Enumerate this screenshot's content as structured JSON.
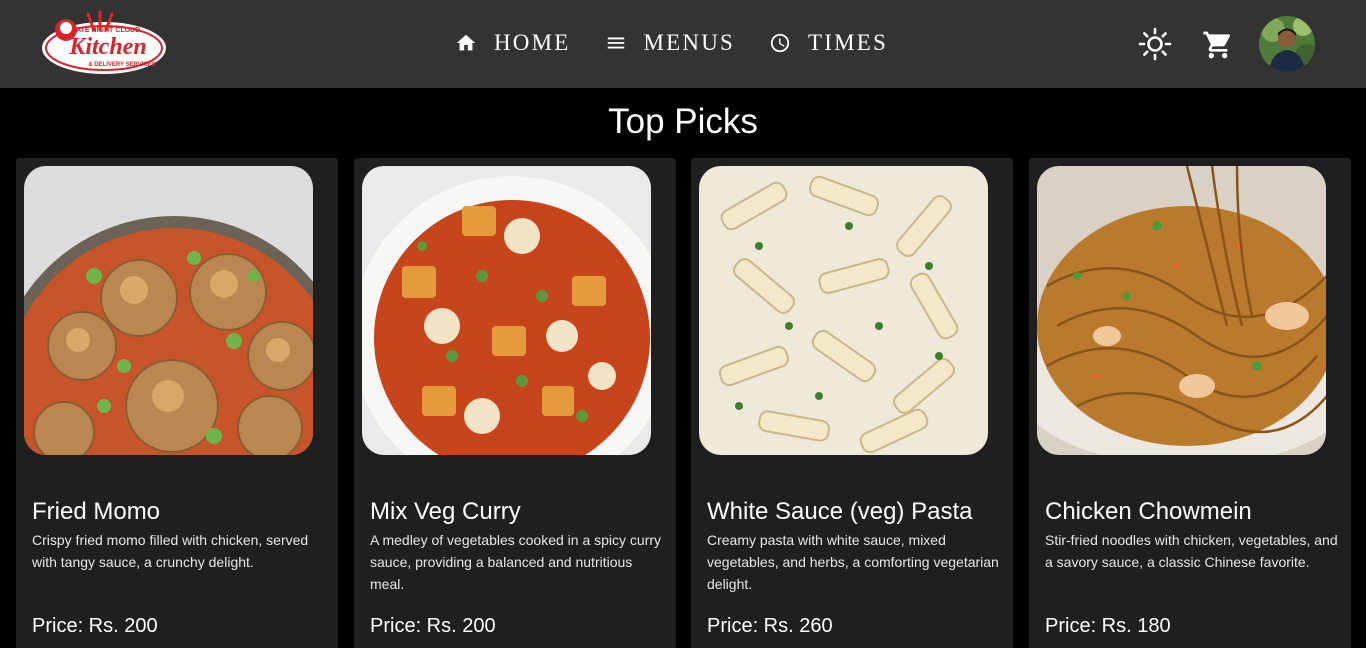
{
  "brand": {
    "logo_line1": "LATE NIGHT CLOUD",
    "logo_line2": "Kitchen",
    "logo_line3": "& DELIVERY SERVICES"
  },
  "nav": {
    "items": [
      {
        "label": "HOME",
        "icon": "home-icon"
      },
      {
        "label": "MENUS",
        "icon": "menu-icon"
      },
      {
        "label": "TIMES",
        "icon": "clock-icon"
      }
    ],
    "theme_icon": "sun-icon",
    "cart_icon": "cart-icon",
    "avatar": "user-avatar"
  },
  "section": {
    "title": "Top Picks"
  },
  "cards": [
    {
      "name": "Fried Momo",
      "description": "Crispy fried momo filled with chicken, served with tangy sauce, a crunchy delight.",
      "price": "Price: Rs. 200"
    },
    {
      "name": "Mix Veg Curry",
      "description": "A medley of vegetables cooked in a spicy curry sauce, providing a balanced and nutritious meal.",
      "price": "Price: Rs. 200"
    },
    {
      "name": "White Sauce (veg) Pasta",
      "description": "Creamy pasta with white sauce, mixed vegetables, and herbs, a comforting vegetarian delight.",
      "price": "Price: Rs. 260"
    },
    {
      "name": "Chicken Chowmein",
      "description": "Stir-fried noodles with chicken, vegetables, and a savory sauce, a classic Chinese favorite.",
      "price": "Price: Rs. 180"
    }
  ],
  "colors": {
    "navbar": "#333333",
    "background": "#000000",
    "card": "#1f1f1f",
    "logo_red": "#d8232a"
  }
}
